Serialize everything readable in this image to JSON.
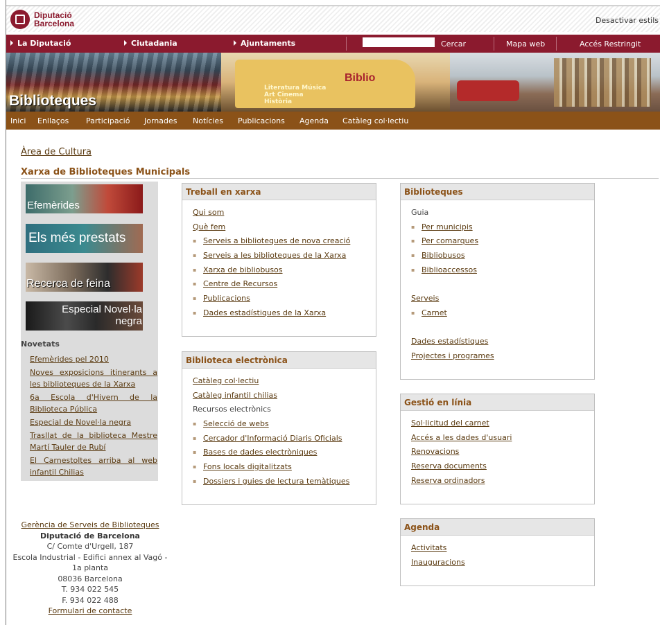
{
  "header": {
    "logo_line1": "Diputació",
    "logo_line2": "Barcelona",
    "desactivar": "Desactivar estils"
  },
  "mainnav": {
    "items": [
      "La Diputació",
      "Ciutadania",
      "Ajuntaments"
    ],
    "search_value": "",
    "search_button": "Cercar",
    "mapa": "Mapa web",
    "acces": "Accés Restringit"
  },
  "banner": {
    "title": "Biblioteques",
    "van_logo": "Biblio",
    "van_words": [
      "Literatura",
      "Art",
      "Música",
      "Història",
      "Cinema"
    ]
  },
  "subnav": [
    "Inici",
    "Enllaços",
    "Participació",
    "Jornades",
    "Notícies",
    "Publicacions",
    "Agenda",
    "Catàleg col·lectiu"
  ],
  "area": "Àrea de Cultura",
  "xarxa": "Xarxa de Biblioteques Municipals",
  "promos": [
    "Efemèrides",
    "Els més prestats",
    "Recerca de feina",
    "Especial Novel·la negra"
  ],
  "novetats": {
    "title": "Novetats",
    "items": [
      "Efemèrides pel 2010",
      "Noves exposicions itinerants a les biblioteques de la Xarxa",
      "6a Escola d'Hivern de la Biblioteca Pública",
      "Especial de Novel·la negra",
      "Trasllat de la biblioteca Mestre Martí Tauler de Rubí",
      "El Carnestoltes arriba al web infantil Chilias"
    ]
  },
  "address": {
    "link": "Gerència de Serveis de Biblioteques",
    "org": "Diputació de Barcelona",
    "line1": "C/ Comte d'Urgell, 187",
    "line2": "Escola Industrial - Edifici annex al Vagó - 1a planta",
    "line3": "08036 Barcelona",
    "phone": "T. 934 022 545",
    "fax": "F. 934 022 488",
    "contact": "Formulari de contacte"
  },
  "boxes": {
    "treball": {
      "title": "Treball en xarxa",
      "top": [
        "Qui som",
        "Què fem"
      ],
      "sub": [
        "Serveis a biblioteques de nova creació",
        "Serveis a les biblioteques de la Xarxa",
        "Xarxa de bibliobusos",
        "Centre de Recursos",
        "Publicacions",
        "Dades estadístiques de la Xarxa"
      ]
    },
    "electronica": {
      "title": "Biblioteca electrònica",
      "top": [
        "Catàleg col·lectiu",
        "Catàleg infantil chilias"
      ],
      "label": "Recursos electrònics",
      "sub": [
        "Selecció de webs",
        "Cercador d'Informació Diaris Oficials",
        "Bases de dades electròniques",
        "Fons locals digitalitzats",
        "Dossiers i guies de lectura temàtiques"
      ]
    },
    "biblioteques": {
      "title": "Biblioteques",
      "guia": "Guia",
      "guia_items": [
        "Per municipis",
        "Per comarques",
        "Bibliobusos",
        "Biblioaccessos"
      ],
      "serveis": "Serveis",
      "serveis_items": [
        "Carnet"
      ],
      "bottom": [
        "Dades estadístiques",
        "Projectes i programes"
      ]
    },
    "gestio": {
      "title": "Gestió en línia",
      "items": [
        "Sol·licitud del carnet",
        "Accés a les dades d'usuari",
        "Renovacions",
        "Reserva documents",
        "Reserva ordinadors"
      ]
    },
    "agenda": {
      "title": "Agenda",
      "items": [
        "Activitats",
        "Inauguracions"
      ]
    }
  }
}
